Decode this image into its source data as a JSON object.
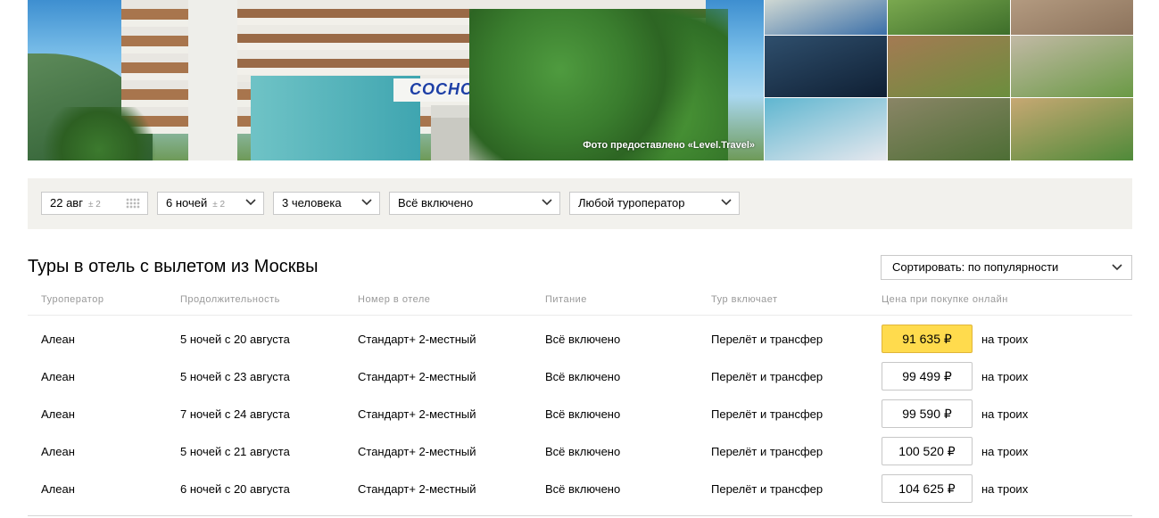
{
  "gallery": {
    "hotel_sign": "СОСНОВАЯ",
    "photo_credit": "Фото предоставлено «Level.Travel»",
    "thumbnails": [
      {
        "name": "park-thumb",
        "colors": [
          "#cfd8d3",
          "#3b6fa8"
        ]
      },
      {
        "name": "garden-thumb",
        "colors": [
          "#7aa84f",
          "#3d6e2a"
        ]
      },
      {
        "name": "stone-carving-thumb",
        "colors": [
          "#b39a80",
          "#8c735c"
        ]
      },
      {
        "name": "stage-show-thumb",
        "colors": [
          "#2f4f6d",
          "#0f1f33"
        ]
      },
      {
        "name": "wood-sculpture-thumb",
        "colors": [
          "#a47a53",
          "#6b8e3d"
        ]
      },
      {
        "name": "stone-arch-thumb",
        "colors": [
          "#c2b9a5",
          "#6a9a45"
        ]
      },
      {
        "name": "kids-dance-thumb",
        "colors": [
          "#5fb6d0",
          "#e6e8ee"
        ]
      },
      {
        "name": "statue-thumb",
        "colors": [
          "#8a8566",
          "#4d6e35"
        ]
      },
      {
        "name": "garden-gate-thumb",
        "colors": [
          "#c7a873",
          "#4f8a39"
        ]
      }
    ]
  },
  "filters": {
    "date": {
      "value": "22 авг",
      "flex": "± 2"
    },
    "nights": {
      "value": "6 ночей",
      "flex": "± 2"
    },
    "people": {
      "value": "3 человека"
    },
    "meal": {
      "value": "Всё включено"
    },
    "operator": {
      "value": "Любой туроператор"
    }
  },
  "section": {
    "title": "Туры в отель с вылетом из Москвы",
    "sort_label": "Сортировать: по популярности"
  },
  "table": {
    "headers": {
      "operator": "Туроператор",
      "duration": "Продолжительность",
      "room": "Номер в отеле",
      "meal": "Питание",
      "includes": "Тур включает",
      "price": "Цена при покупке онлайн"
    },
    "rows": [
      {
        "operator": "Алеан",
        "duration": "5 ночей с 20 августа",
        "room": "Стандарт+ 2-местный",
        "meal": "Всё включено",
        "includes": "Перелёт и трансфер",
        "price": "91 635 ₽",
        "per": "на троих"
      },
      {
        "operator": "Алеан",
        "duration": "5 ночей с 23 августа",
        "room": "Стандарт+ 2-местный",
        "meal": "Всё включено",
        "includes": "Перелёт и трансфер",
        "price": "99 499 ₽",
        "per": "на троих"
      },
      {
        "operator": "Алеан",
        "duration": "7 ночей с 24 августа",
        "room": "Стандарт+ 2-местный",
        "meal": "Всё включено",
        "includes": "Перелёт и трансфер",
        "price": "99 590 ₽",
        "per": "на троих"
      },
      {
        "operator": "Алеан",
        "duration": "5 ночей с 21 августа",
        "room": "Стандарт+ 2-местный",
        "meal": "Всё включено",
        "includes": "Перелёт и трансфер",
        "price": "100 520 ₽",
        "per": "на троих"
      },
      {
        "operator": "Алеан",
        "duration": "6 ночей с 20 августа",
        "room": "Стандарт+ 2-местный",
        "meal": "Всё включено",
        "includes": "Перелёт и трансфер",
        "price": "104 625 ₽",
        "per": "на троих"
      }
    ]
  },
  "colors": {
    "accent_price": "#ffdb4d",
    "filter_bg": "#f2f1ed"
  }
}
